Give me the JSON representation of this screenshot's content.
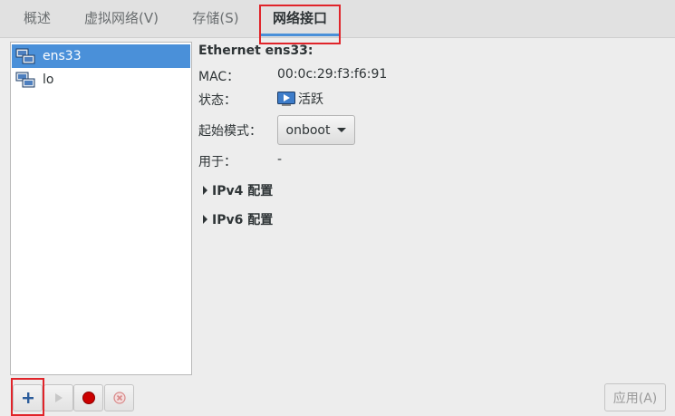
{
  "tabs": [
    {
      "label": "概述"
    },
    {
      "label": "虚拟网络(V)"
    },
    {
      "label": "存储(S)"
    },
    {
      "label": "网络接口"
    }
  ],
  "active_tab_index": 3,
  "interfaces": [
    {
      "name": "ens33",
      "selected": true,
      "icon": "network-card-icon"
    },
    {
      "name": "lo",
      "selected": false,
      "icon": "network-card-icon"
    }
  ],
  "detail": {
    "title": "Ethernet ens33:",
    "mac_label": "MAC：",
    "mac_value": "00:0c:29:f3:f6:91",
    "state_label": "状态：",
    "state_value": "活跃",
    "state_icon": "play-icon",
    "start_mode_label": "起始模式：",
    "start_mode_value": "onboot",
    "used_by_label": "用于：",
    "used_by_value": "-",
    "ipv4_label": "IPv4 配置",
    "ipv6_label": "IPv6 配置"
  },
  "toolbar": {
    "add": "add-icon",
    "start": "play-icon",
    "stop": "record-stop-icon",
    "delete": "delete-circle-icon"
  },
  "apply_label": "应用(A)",
  "colors": {
    "selection": "#4a90d9",
    "highlight_box": "#e0242a",
    "stop_red": "#cc0000"
  }
}
